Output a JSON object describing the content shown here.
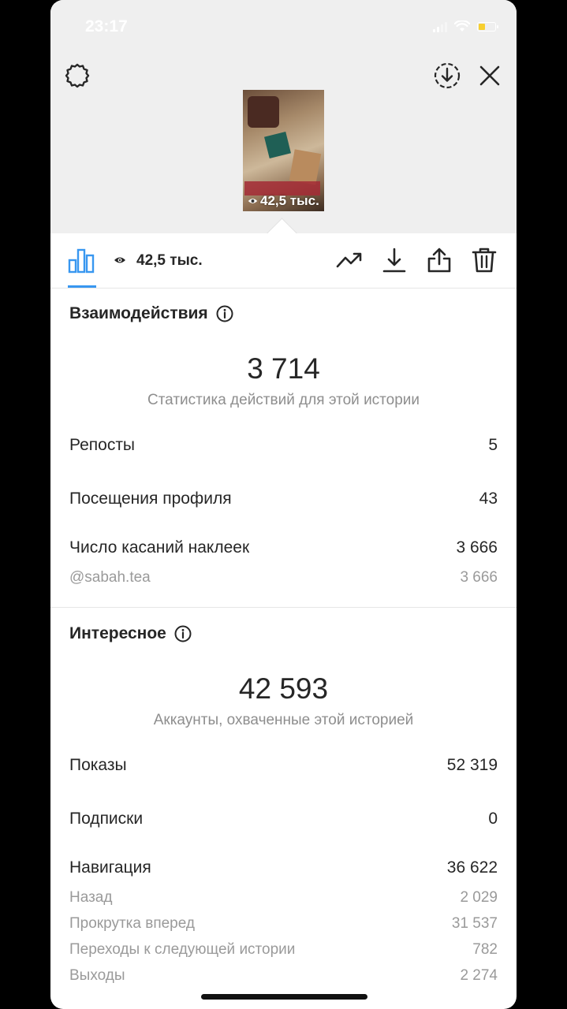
{
  "status": {
    "time": "23:17"
  },
  "story": {
    "views_overlay": "42,5 тыс."
  },
  "toolbar": {
    "views": "42,5 тыс."
  },
  "interactions": {
    "title": "Взаимодействия",
    "total": "3 714",
    "caption": "Статистика действий для этой истории",
    "rows": [
      {
        "label": "Репосты",
        "value": "5"
      },
      {
        "label": "Посещения профиля",
        "value": "43"
      },
      {
        "label": "Число касаний наклеек",
        "value": "3 666"
      }
    ],
    "sticker_detail": {
      "label": "@sabah.tea",
      "value": "3 666"
    }
  },
  "discovery": {
    "title": "Интересное",
    "total": "42 593",
    "caption": "Аккаунты, охваченные этой историей",
    "rows": [
      {
        "label": "Показы",
        "value": "52 319"
      },
      {
        "label": "Подписки",
        "value": "0"
      },
      {
        "label": "Навигация",
        "value": "36 622"
      }
    ],
    "navigation_details": [
      {
        "label": "Назад",
        "value": "2 029"
      },
      {
        "label": "Прокрутка вперед",
        "value": "31 537"
      },
      {
        "label": "Переходы к следующей истории",
        "value": "782"
      },
      {
        "label": "Выходы",
        "value": "2 274"
      }
    ]
  },
  "colors": {
    "accent": "#3897f0",
    "battery": "#f7cf2f",
    "text": "#262626",
    "secondary": "#8e8e8e"
  }
}
